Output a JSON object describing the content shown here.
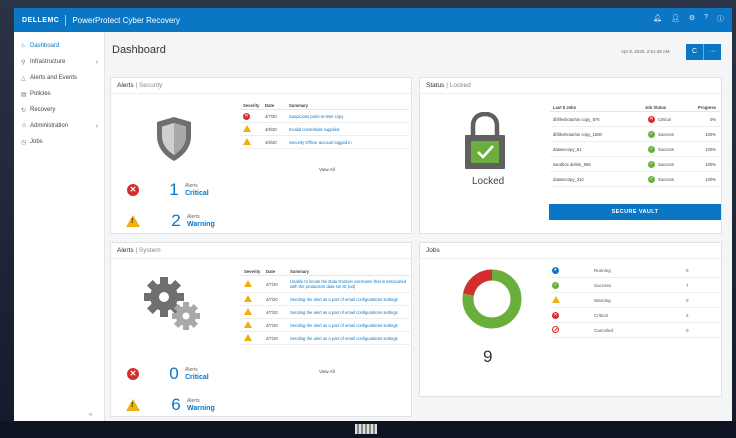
{
  "header": {
    "brand": "DELLEMC",
    "product": "PowerProtect Cyber Recovery",
    "icons": [
      "bell-icon",
      "user-icon",
      "settings-icon",
      "help-icon",
      "info-icon"
    ]
  },
  "sidebar": {
    "items": [
      {
        "label": "Dashboard",
        "icon": "dashboard-icon",
        "active": true,
        "chevron": false
      },
      {
        "label": "Infrastructure",
        "icon": "infrastructure-icon",
        "active": false,
        "chevron": true
      },
      {
        "label": "Alerts and Events",
        "icon": "alerts-icon",
        "active": false,
        "chevron": false
      },
      {
        "label": "Policies",
        "icon": "policies-icon",
        "active": false,
        "chevron": false
      },
      {
        "label": "Recovery",
        "icon": "recovery-icon",
        "active": false,
        "chevron": false
      },
      {
        "label": "Administration",
        "icon": "admin-icon",
        "active": false,
        "chevron": true
      },
      {
        "label": "Jobs",
        "icon": "jobs-icon",
        "active": false,
        "chevron": false
      }
    ],
    "collapse": "«"
  },
  "page": {
    "title": "Dashboard",
    "date": "Apr 8, 2020, 2:51:38 AM",
    "refresh": "C",
    "more": "···"
  },
  "alerts_security": {
    "title": "Alerts",
    "subtitle": "| Security",
    "columns": [
      "Severity",
      "Date",
      "Summary"
    ],
    "rows": [
      {
        "severity": "critical",
        "date": "4/7/20",
        "summary": "Suspicious point-in-time copy"
      },
      {
        "severity": "warning",
        "date": "4/6/20",
        "summary": "Invalid credentials supplied"
      },
      {
        "severity": "warning",
        "date": "4/6/20",
        "summary": "Security Officer account logged in"
      }
    ],
    "view_all": "View All",
    "critical": {
      "count": "1",
      "label_a": "Alerts",
      "label_b": "Critical"
    },
    "warning": {
      "count": "2",
      "label_a": "Alerts",
      "label_b": "Warning"
    }
  },
  "status": {
    "title": "Status",
    "subtitle": "| Locked",
    "state": "Locked",
    "columns": [
      "Last 5 Jobs",
      "Job Status",
      "Progress"
    ],
    "rows": [
      {
        "name": "dbfileshotarlon copy_876",
        "status": "Critical",
        "kind": "critical",
        "progress": "0%"
      },
      {
        "name": "dbfileshotarlon copy_1500",
        "status": "Success",
        "kind": "ok",
        "progress": "100%"
      },
      {
        "name": "datasecopy_61",
        "status": "Success",
        "kind": "ok",
        "progress": "100%"
      },
      {
        "name": "sandbox delete_555",
        "status": "Success",
        "kind": "ok",
        "progress": "100%"
      },
      {
        "name": "datasecopy_310",
        "status": "Success",
        "kind": "ok",
        "progress": "100%"
      }
    ],
    "button": "SECURE VAULT"
  },
  "alerts_system": {
    "title": "Alerts",
    "subtitle": "| System",
    "columns": [
      "Severity",
      "Date",
      "Summary"
    ],
    "rows": [
      {
        "severity": "warning",
        "date": "4/7/20",
        "summary": "Unable to locate the Data Domain username that is associated with the production data set ID (ud)"
      },
      {
        "severity": "warning",
        "date": "4/7/20",
        "summary": "Sending the alert as a part of email configurations settings"
      },
      {
        "severity": "warning",
        "date": "4/7/20",
        "summary": "Sending the alert as a part of email configurations settings"
      },
      {
        "severity": "warning",
        "date": "4/7/20",
        "summary": "Sending the alert as a part of email configurations settings"
      },
      {
        "severity": "warning",
        "date": "4/7/20",
        "summary": "Sending the alert as a part of email configurations settings"
      }
    ],
    "view_all": "View All",
    "critical": {
      "count": "0",
      "label_a": "Alerts",
      "label_b": "Critical"
    },
    "warning": {
      "count": "6",
      "label_a": "Alerts",
      "label_b": "Warning"
    }
  },
  "jobs": {
    "title": "Jobs",
    "total": "9",
    "rows": [
      {
        "kind": "run",
        "label": "Running",
        "value": "0"
      },
      {
        "kind": "ok",
        "label": "Success",
        "value": "7"
      },
      {
        "kind": "warn",
        "label": "Warning",
        "value": "0"
      },
      {
        "kind": "critical",
        "label": "Critical",
        "value": "2"
      },
      {
        "kind": "cancel",
        "label": "Canceled",
        "value": "0"
      }
    ],
    "colors": {
      "success": "#6aaf3c",
      "critical": "#d42d2d"
    }
  },
  "colors": {
    "accent": "#0b76c3",
    "warning": "#f0b00c"
  }
}
